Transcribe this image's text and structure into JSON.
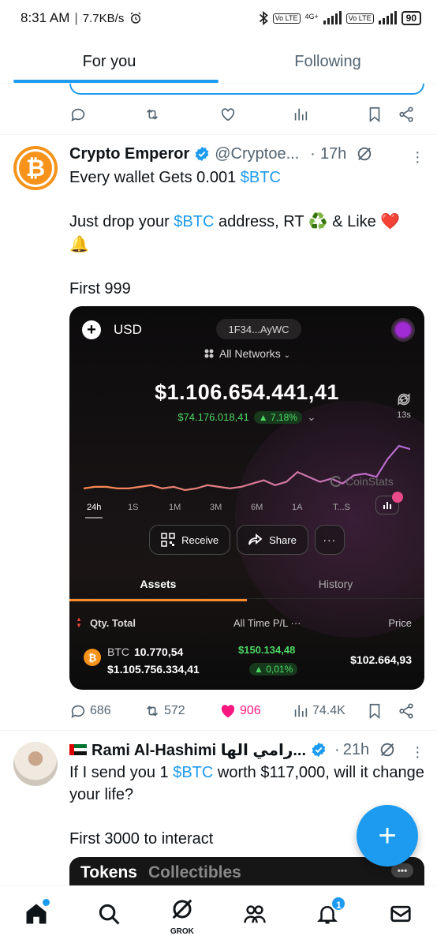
{
  "status_bar": {
    "time": "8:31 AM",
    "speed": "7.7KB/s",
    "network_1": "Vo LTE",
    "network_2": "4G+",
    "network_3": "Vo LTE",
    "battery": "90"
  },
  "tabs": [
    {
      "label": "For you",
      "active": true
    },
    {
      "label": "Following",
      "active": false
    }
  ],
  "tweet1": {
    "name": "Crypto Emperor",
    "handle": "@Cryptoe...",
    "dot": "·",
    "time": "17h",
    "line1_pre": "Every wallet Gets 0.001 ",
    "line1_tag": "$BTC",
    "line2_pre": "Just drop your ",
    "line2_tag": "$BTC",
    "line2_post": "  address, RT ♻️ & Like ❤️",
    "line3": "🔔",
    "line4": "First 999",
    "stats": {
      "replies": "686",
      "reposts": "572",
      "likes": "906",
      "views": "74.4K"
    },
    "likes_color": "#f91880"
  },
  "wallet": {
    "currency": "USD",
    "address": "1F34...AyWC",
    "networks": "All Networks",
    "balance": "$1.106.654.441,41",
    "change_amount": "$74.176.018,41",
    "change_pct": "▲ 7,18%",
    "refresh_timer": "13s",
    "watermark": "CoinStats",
    "ranges": [
      "24h",
      "1S",
      "1M",
      "3M",
      "6M",
      "1A",
      "T...S"
    ],
    "active_range": "24h",
    "buttons": {
      "receive": "Receive",
      "share": "Share",
      "more": "···"
    },
    "tabs": {
      "assets": "Assets",
      "history": "History"
    },
    "columns": {
      "qty": "Qty. Total",
      "pl": "All Time P/L ···",
      "price": "Price"
    },
    "asset": {
      "symbol": "BTC",
      "quantity": "10.770,54",
      "total": "$1.105.756.334,41",
      "pl_value": "$150.134,48",
      "pl_pct": "▲ 0,01%",
      "price": "$102.664,93"
    },
    "chart_data": {
      "type": "line",
      "x": [
        1,
        2,
        3,
        4,
        5,
        6,
        7,
        8,
        9,
        10,
        11,
        12,
        13,
        14,
        15,
        16,
        17,
        18,
        19,
        20,
        21,
        22,
        23,
        24,
        25,
        26,
        27,
        28,
        29,
        30
      ],
      "values": [
        12,
        13,
        13,
        12,
        12,
        13,
        14,
        12,
        13,
        11,
        12,
        14,
        13,
        12,
        13,
        15,
        17,
        14,
        16,
        22,
        19,
        16,
        18,
        15,
        20,
        21,
        19,
        30,
        38,
        36
      ],
      "accent_start": "#ff8a4a",
      "accent_end": "#b36ad8"
    }
  },
  "tweet2": {
    "name": "Rami Al-Hashimi رامي الها...",
    "dot": "·",
    "time": "21h",
    "line1_pre": "If I send you 1 ",
    "line1_tag": "$BTC",
    "line1_post": " worth $117,000, will it change your life?",
    "line2": "First 3000 to interact",
    "card_tab1": "Tokens",
    "card_tab2": "Collectibles"
  },
  "fab_icon": "plus-icon",
  "bottom_nav": {
    "grok_label": "GROK",
    "notifications_count": "1"
  },
  "colors": {
    "accent": "#1d9bf0",
    "verified": "#1d9bf0"
  }
}
